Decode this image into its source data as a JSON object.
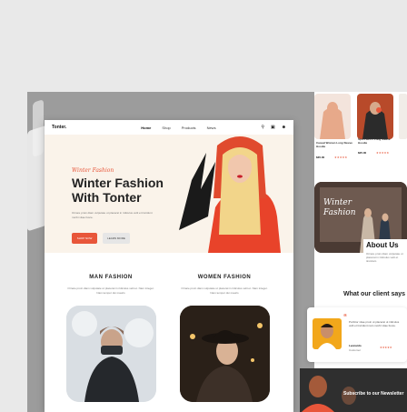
{
  "nav": {
    "logo": "Tonter.",
    "items": [
      "Home",
      "Shop",
      "Products",
      "News"
    ]
  },
  "hero": {
    "script": "Winter Fashion",
    "title": "Winter Fashion With Tonter",
    "description": "Ornare proin diam vulputate ut placerat in ridiculus velit et tincidunt morbi vitae fusce.",
    "shop_now": "SHOP NOW",
    "learn_more": "LEARN MORE"
  },
  "sections": {
    "man": {
      "title": "MAN FASHION",
      "description": "Ornare proin diam vulputate ut placerat in ridiculus velit et. Nam integer. Nam tempor dui mauris"
    },
    "women": {
      "title": "WOMEN FASHION",
      "description": "Ornare proin diam vulputate ut placerat in ridiculus velit et. Nam integer. Nam tempor dui mauris"
    }
  },
  "products": [
    {
      "name": "Casual Women Long Sleeve Hoodie",
      "price": "$35.00"
    },
    {
      "name": "Sport Men's Long Sleeve Hoodie",
      "price": "$25.00"
    }
  ],
  "promo": {
    "text": "Winter Fashion"
  },
  "about": {
    "title": "About Us",
    "text": "Ornare proin diam vulputate ut placerat in ridiculus velit et tincidunt."
  },
  "clients": {
    "title": "What our client says",
    "quote": "Porttitor vitae proin ut placerat ut ridiculus velit et tincidunt nam morbi vitae fusce.",
    "name": "Leonardo",
    "role": "Customer"
  },
  "newsletter": {
    "title": "Subscribe to our Newsletter"
  },
  "colors": {
    "accent": "#e8563a",
    "hero_bg": "#faf3ea"
  }
}
